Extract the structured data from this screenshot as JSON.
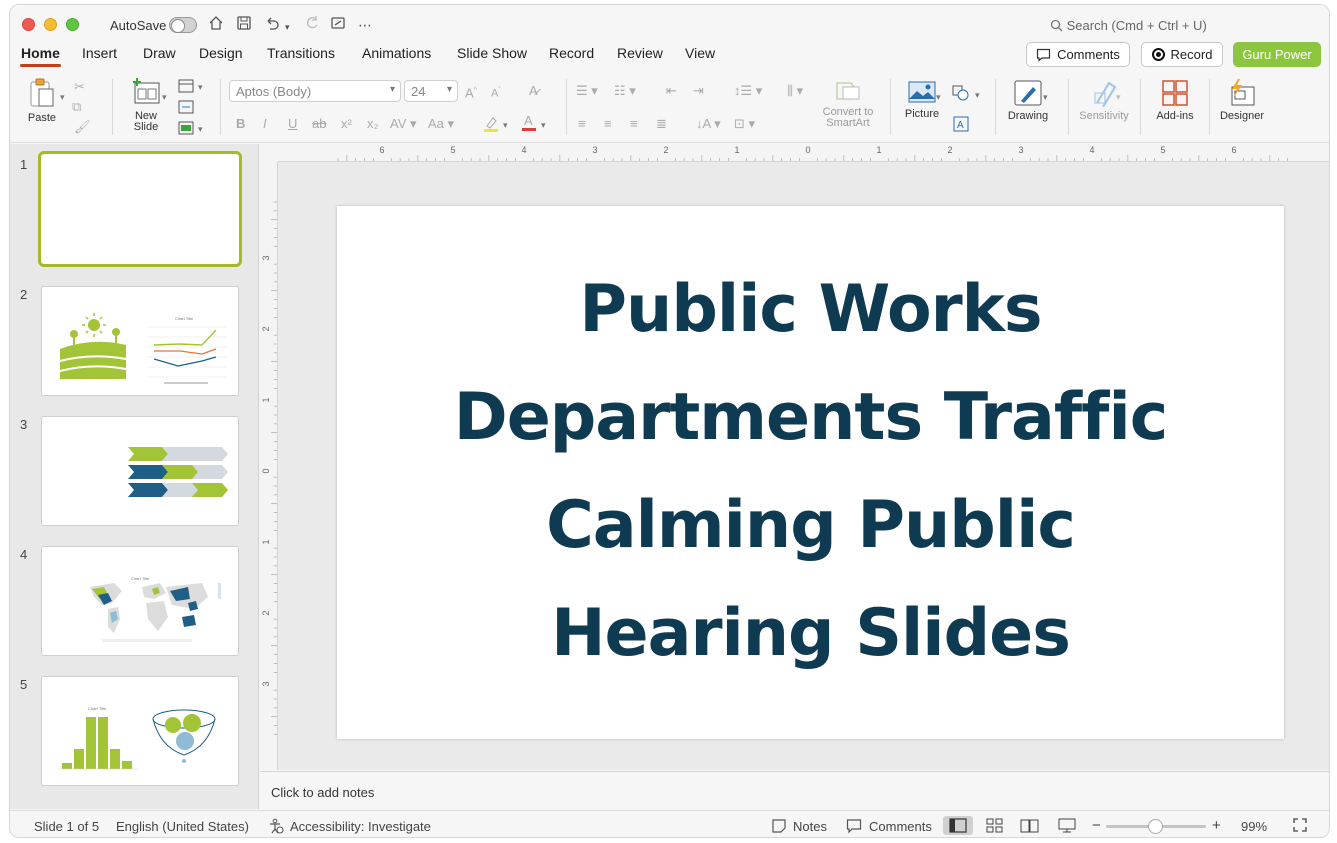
{
  "titlebar": {
    "autosave_label": "AutoSave",
    "search_placeholder": "Search (Cmd + Ctrl + U)"
  },
  "tabs": [
    "Home",
    "Insert",
    "Draw",
    "Design",
    "Transitions",
    "Animations",
    "Slide Show",
    "Record",
    "Review",
    "View"
  ],
  "header_buttons": {
    "comments": "Comments",
    "record": "Record",
    "guru": "Guru Power"
  },
  "ribbon": {
    "paste": "Paste",
    "new_slide_line1": "New",
    "new_slide_line2": "Slide",
    "font_name": "Aptos (Body)",
    "font_size": "24",
    "convert_line1": "Convert to",
    "convert_line2": "SmartArt",
    "picture": "Picture",
    "drawing": "Drawing",
    "sensitivity": "Sensitivity",
    "addins": "Add-ins",
    "designer": "Designer"
  },
  "slides": {
    "numbers": [
      "1",
      "2",
      "3",
      "4",
      "5"
    ],
    "thumb2_chart_title": "Chart Title",
    "thumb4_chart_title": "Chart Title",
    "thumb5_chart_title": "Chart Title"
  },
  "main_slide": {
    "title_lines": [
      "Public Works",
      "Departments Traffic",
      "Calming Public",
      "Hearing Slides"
    ]
  },
  "ruler": {
    "top_labels": [
      "6",
      "5",
      "4",
      "3",
      "2",
      "1",
      "0",
      "1",
      "2",
      "3",
      "4",
      "5",
      "6"
    ],
    "left_labels": [
      "3",
      "2",
      "1",
      "0",
      "1",
      "2",
      "3"
    ]
  },
  "notes_placeholder": "Click to add notes",
  "status": {
    "slide_info": "Slide 1 of 5",
    "language": "English (United States)",
    "accessibility": "Accessibility: Investigate",
    "notes": "Notes",
    "comments": "Comments",
    "zoom": "99%",
    "zoom_fraction": 0.49
  },
  "colors": {
    "title_text": "#0e3a52",
    "accent_green": "#8cc63f",
    "tab_underline": "#c43e1c",
    "thumb_green": "#a4c437",
    "thumb_blue": "#1f5f86"
  }
}
